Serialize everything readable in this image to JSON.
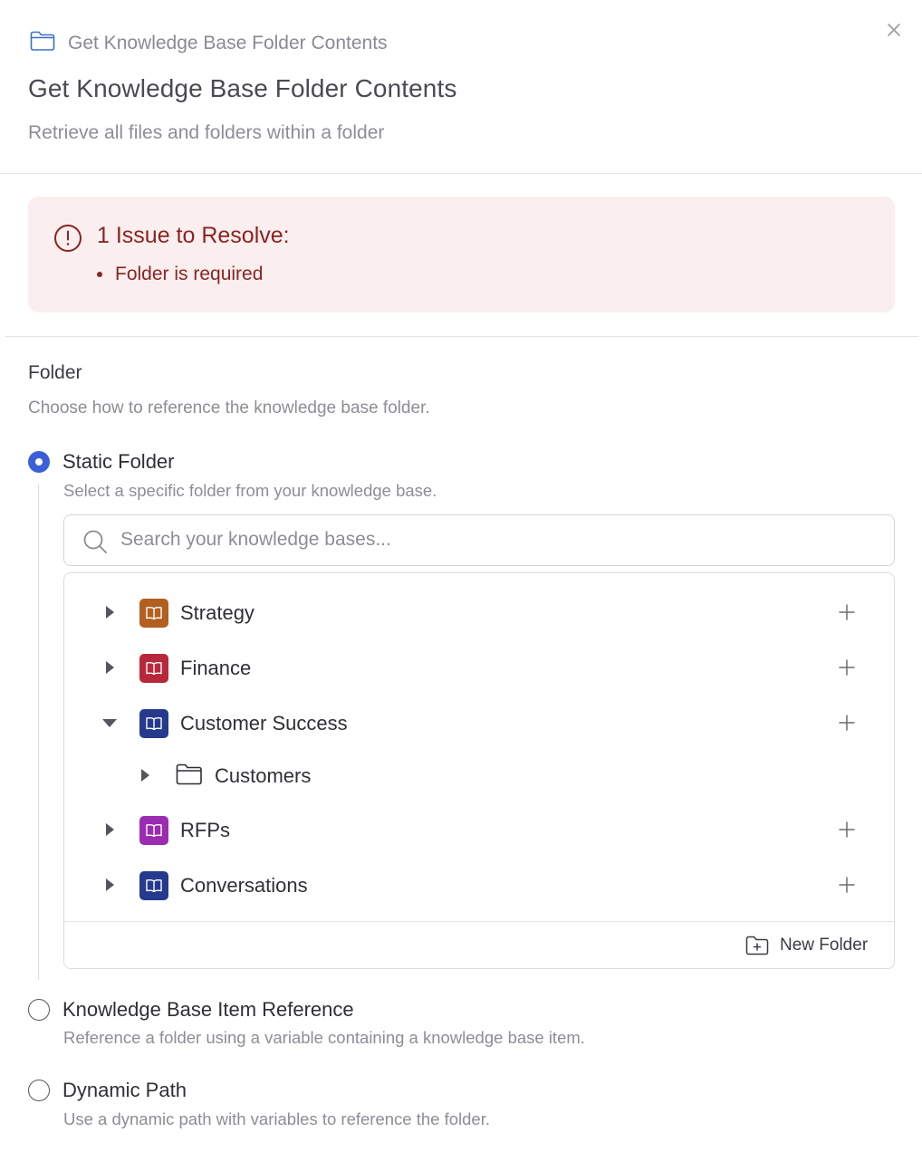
{
  "header": {
    "breadcrumb": "Get Knowledge Base Folder Contents",
    "title": "Get Knowledge Base Folder Contents",
    "subtitle": "Retrieve all files and folders within a folder"
  },
  "alert": {
    "title": "1 Issue to Resolve:",
    "items": [
      "Folder is required"
    ],
    "color": "#8b2424",
    "background": "#fbeeee"
  },
  "folder": {
    "label": "Folder",
    "description": "Choose how to reference the knowledge base folder.",
    "options": [
      {
        "label": "Static Folder",
        "description": "Select a specific folder from your knowledge base.",
        "selected": true
      },
      {
        "label": "Knowledge Base Item Reference",
        "description": "Reference a folder using a variable containing a knowledge base item.",
        "selected": false
      },
      {
        "label": "Dynamic Path",
        "description": "Use a dynamic path with variables to reference the folder.",
        "selected": false
      }
    ]
  },
  "search": {
    "placeholder": "Search your knowledge bases...",
    "value": ""
  },
  "tree": {
    "items": [
      {
        "label": "Strategy",
        "icon": "book-icon",
        "color": "#b35f22",
        "expanded": false
      },
      {
        "label": "Finance",
        "icon": "book-icon",
        "color": "#b8283a",
        "expanded": false
      },
      {
        "label": "Customer Success",
        "icon": "book-icon",
        "color": "#253a8c",
        "expanded": true,
        "children": [
          {
            "label": "Customers",
            "icon": "folder-icon"
          }
        ]
      },
      {
        "label": "RFPs",
        "icon": "book-icon",
        "color": "#9b2bb0",
        "expanded": false
      },
      {
        "label": "Conversations",
        "icon": "book-icon",
        "color": "#253a8c",
        "expanded": false
      }
    ],
    "new_folder_label": "New Folder"
  },
  "accent": "#3b5fd9"
}
